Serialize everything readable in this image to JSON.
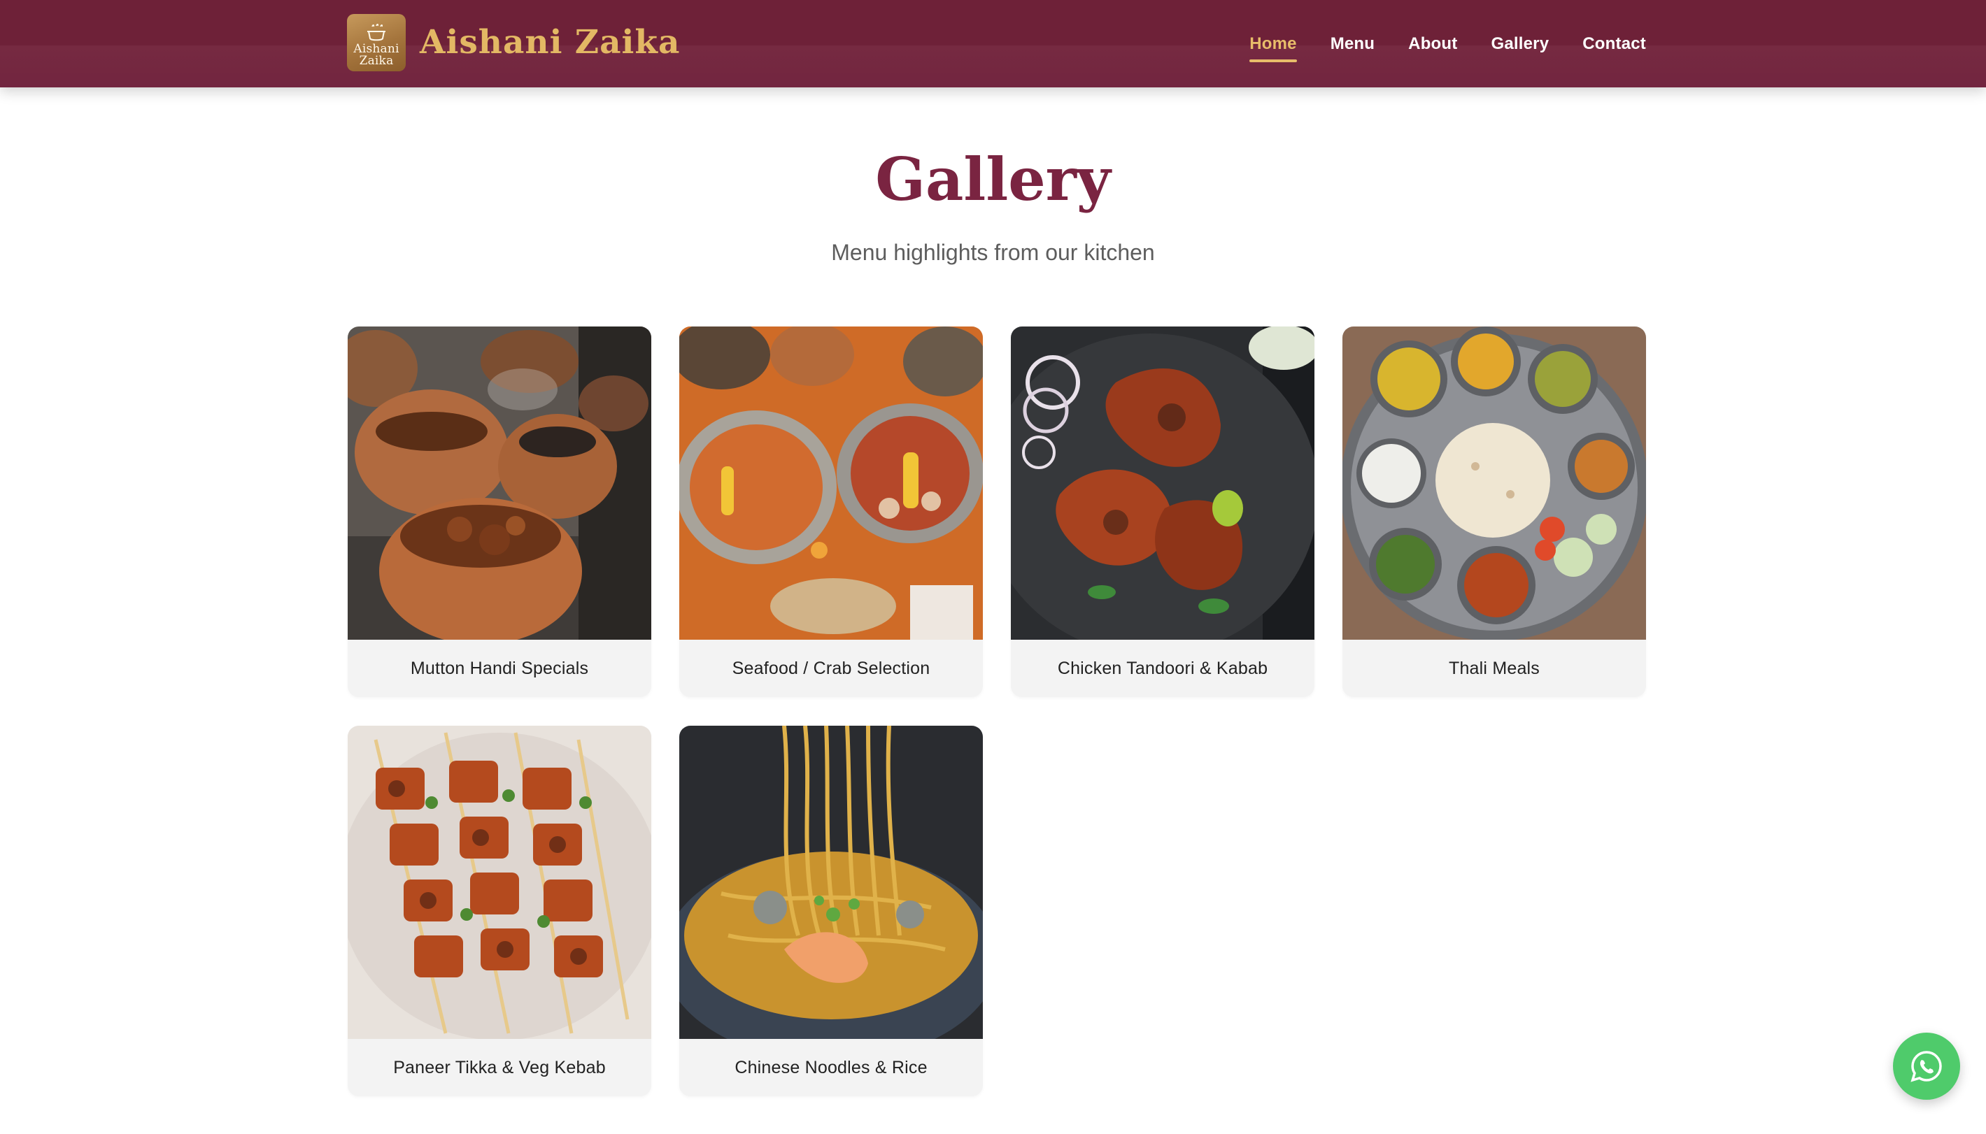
{
  "brand": {
    "logo_line1": "Aishani",
    "logo_line2": "Zaika",
    "name": "Aishani Zaika"
  },
  "nav": {
    "items": [
      {
        "label": "Home",
        "active": true
      },
      {
        "label": "Menu",
        "active": false
      },
      {
        "label": "About",
        "active": false
      },
      {
        "label": "Gallery",
        "active": false
      },
      {
        "label": "Contact",
        "active": false
      }
    ]
  },
  "gallery": {
    "title": "Gallery",
    "subtitle": "Menu highlights from our kitchen",
    "items": [
      {
        "caption": "Mutton Handi Specials",
        "image": "mutton-handi-photo"
      },
      {
        "caption": "Seafood / Crab Selection",
        "image": "seafood-crab-photo"
      },
      {
        "caption": "Chicken Tandoori & Kabab",
        "image": "chicken-tandoori-photo"
      },
      {
        "caption": "Thali Meals",
        "image": "thali-meals-photo"
      },
      {
        "caption": "Paneer Tikka & Veg Kebab",
        "image": "paneer-tikka-photo"
      },
      {
        "caption": "Chinese Noodles & Rice",
        "image": "chinese-noodles-photo"
      }
    ]
  },
  "whatsapp": {
    "icon": "whatsapp-icon"
  },
  "colors": {
    "header_bg": "#6e2138",
    "accent_gold": "#e8bd6a",
    "title_maroon": "#7a2441",
    "whatsapp_green": "#4fcb6b"
  }
}
